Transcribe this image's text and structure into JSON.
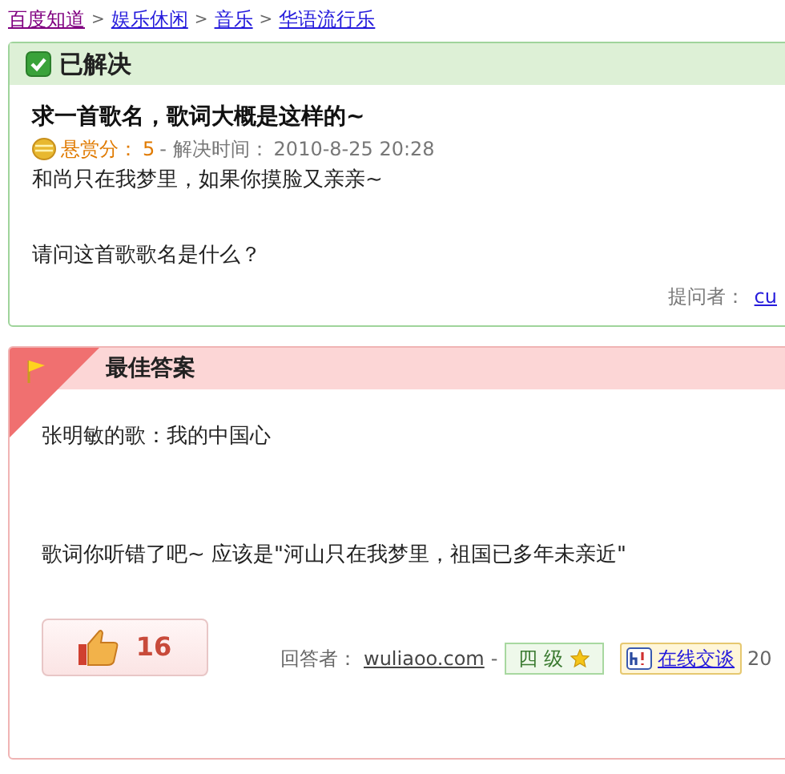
{
  "breadcrumb": [
    {
      "label": "百度知道",
      "visited": true
    },
    {
      "label": "娱乐休闲",
      "visited": false
    },
    {
      "label": "音乐",
      "visited": false
    },
    {
      "label": "华语流行乐",
      "visited": false
    }
  ],
  "breadcrumb_separator": ">",
  "question": {
    "status": "已解决",
    "title": "求一首歌名，歌词大概是这样的~",
    "reward_label": "悬赏分：",
    "reward": "5",
    "solved_label": "- 解决时间：",
    "solved_time": "2010-8-25 20:28",
    "body": [
      "和尚只在我梦里，如果你摸脸又亲亲~",
      "请问这首歌歌名是什么？"
    ],
    "asker_label": "提问者：",
    "asker": "cu"
  },
  "best_answer": {
    "heading": "最佳答案",
    "body": [
      "张明敏的歌：我的中国心",
      "歌词你听错了吧~  应该是\"河山只在我梦里，祖国已多年未亲近\""
    ],
    "votes": "16",
    "answerer_label": "回答者：",
    "answerer": "wuliaoo.com",
    "dash": "-",
    "level": "四 级",
    "chat": "在线交谈",
    "time": "20"
  }
}
